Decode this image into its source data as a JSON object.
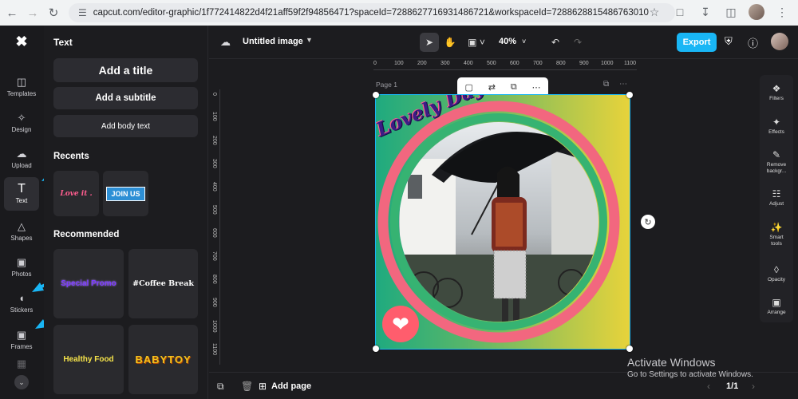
{
  "browser": {
    "url": "capcut.com/editor-graphic/1f772414822d4f21aff59f2f94856471?spaceId=7288627716931486721&workspaceId=7288628815486763010",
    "back_icon": "arrow-left-icon",
    "forward_icon": "arrow-right-icon",
    "reload_icon": "reload-icon"
  },
  "rail": {
    "items": [
      {
        "label": "Templates",
        "icon": "templates-icon"
      },
      {
        "label": "Design",
        "icon": "design-icon"
      },
      {
        "label": "Upload",
        "icon": "upload-icon"
      },
      {
        "label": "Text",
        "icon": "text-icon"
      },
      {
        "label": "Shapes",
        "icon": "shapes-icon"
      },
      {
        "label": "Photos",
        "icon": "photos-icon"
      },
      {
        "label": "Stickers",
        "icon": "stickers-icon"
      },
      {
        "label": "Frames",
        "icon": "frames-icon"
      }
    ],
    "active": "Text"
  },
  "panel": {
    "title": "Text",
    "add_title": "Add a title",
    "add_subtitle": "Add a subtitle",
    "add_body": "Add body text",
    "recents_label": "Recents",
    "recents": [
      "Love it .",
      "JOIN US"
    ],
    "recommended_label": "Recommended",
    "recommended": [
      "Special Promo",
      "#Coffee Break",
      "Healthy Food",
      "BABYTOY"
    ]
  },
  "topbar": {
    "title": "Untitled image",
    "zoom": "40%",
    "export_label": "Export"
  },
  "ruler": {
    "h_ticks": [
      "0",
      "100",
      "200",
      "300",
      "400",
      "500",
      "600",
      "700",
      "800",
      "900",
      "1000",
      "1100"
    ],
    "v_ticks": [
      "0",
      "100",
      "200",
      "300",
      "400",
      "500",
      "600",
      "700",
      "800",
      "900",
      "1000",
      "1100"
    ]
  },
  "canvas": {
    "page_label": "Page 1",
    "headline": "Lovely Day",
    "accent_color": "#19b6f5"
  },
  "right_tools": [
    {
      "label": "Filters",
      "icon": "filters-icon"
    },
    {
      "label": "Effects",
      "icon": "effects-icon"
    },
    {
      "label": "Remove backgr...",
      "icon": "remove-background-icon"
    },
    {
      "label": "Adjust",
      "icon": "adjust-icon"
    },
    {
      "label": "Smart tools",
      "icon": "smart-tools-icon"
    },
    {
      "label": "Opacity",
      "icon": "opacity-icon"
    },
    {
      "label": "Arrange",
      "icon": "arrange-icon"
    }
  ],
  "bottom": {
    "add_page": "Add page",
    "pager": "1/1"
  },
  "watermark": {
    "title": "Activate Windows",
    "subtitle": "Go to Settings to activate Windows."
  }
}
